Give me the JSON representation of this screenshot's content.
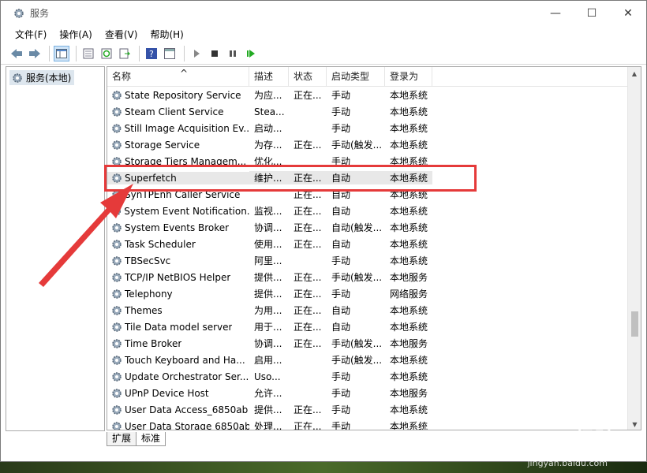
{
  "window": {
    "title": "服务",
    "controls": {
      "minimize": "—",
      "maximize": "☐",
      "close": "✕"
    }
  },
  "menu": [
    "文件(F)",
    "操作(A)",
    "查看(V)",
    "帮助(H)"
  ],
  "tree": {
    "root_label": "服务(本地)"
  },
  "columns": {
    "name": "名称",
    "desc": "描述",
    "status": "状态",
    "start": "启动类型",
    "logon": "登录为"
  },
  "rows": [
    {
      "name": "State Repository Service",
      "desc": "为应...",
      "status": "正在...",
      "start": "手动",
      "logon": "本地系统"
    },
    {
      "name": "Steam Client Service",
      "desc": "Stea...",
      "status": "",
      "start": "手动",
      "logon": "本地系统"
    },
    {
      "name": "Still Image Acquisition Ev...",
      "desc": "启动...",
      "status": "",
      "start": "手动",
      "logon": "本地系统"
    },
    {
      "name": "Storage Service",
      "desc": "为存...",
      "status": "正在...",
      "start": "手动(触发...",
      "logon": "本地系统"
    },
    {
      "name": "Storage Tiers Managem...",
      "desc": "优化...",
      "status": "",
      "start": "手动",
      "logon": "本地系统"
    },
    {
      "name": "Superfetch",
      "desc": "维护...",
      "status": "正在...",
      "start": "自动",
      "logon": "本地系统",
      "selected": true
    },
    {
      "name": "SynTPEnh Caller Service",
      "desc": "",
      "status": "正在...",
      "start": "自动",
      "logon": "本地系统"
    },
    {
      "name": "System Event Notification...",
      "desc": "监视...",
      "status": "正在...",
      "start": "自动",
      "logon": "本地系统"
    },
    {
      "name": "System Events Broker",
      "desc": "协调...",
      "status": "正在...",
      "start": "自动(触发...",
      "logon": "本地系统"
    },
    {
      "name": "Task Scheduler",
      "desc": "使用...",
      "status": "正在...",
      "start": "自动",
      "logon": "本地系统"
    },
    {
      "name": "TBSecSvc",
      "desc": "阿里...",
      "status": "",
      "start": "手动",
      "logon": "本地系统"
    },
    {
      "name": "TCP/IP NetBIOS Helper",
      "desc": "提供...",
      "status": "正在...",
      "start": "手动(触发...",
      "logon": "本地服务"
    },
    {
      "name": "Telephony",
      "desc": "提供...",
      "status": "正在...",
      "start": "手动",
      "logon": "网络服务"
    },
    {
      "name": "Themes",
      "desc": "为用...",
      "status": "正在...",
      "start": "自动",
      "logon": "本地系统"
    },
    {
      "name": "Tile Data model server",
      "desc": "用于...",
      "status": "正在...",
      "start": "自动",
      "logon": "本地系统"
    },
    {
      "name": "Time Broker",
      "desc": "协调...",
      "status": "正在...",
      "start": "手动(触发...",
      "logon": "本地服务"
    },
    {
      "name": "Touch Keyboard and Ha...",
      "desc": "启用...",
      "status": "",
      "start": "手动(触发...",
      "logon": "本地系统"
    },
    {
      "name": "Update Orchestrator Ser...",
      "desc": "Uso...",
      "status": "",
      "start": "手动",
      "logon": "本地系统"
    },
    {
      "name": "UPnP Device Host",
      "desc": "允许...",
      "status": "",
      "start": "手动",
      "logon": "本地服务"
    },
    {
      "name": "User Data Access_6850ab",
      "desc": "提供...",
      "status": "正在...",
      "start": "手动",
      "logon": "本地系统"
    },
    {
      "name": "User Data Storage 6850ab",
      "desc": "处理...",
      "status": "正在...",
      "start": "手动",
      "logon": "本地系统"
    }
  ],
  "tabs": [
    "扩展",
    "标准"
  ],
  "watermark": {
    "logo": "Baidu经验",
    "url": "jingyan.baidu.com"
  },
  "colors": {
    "highlight": "#e53a3a",
    "selection": "#e8e8e8"
  }
}
